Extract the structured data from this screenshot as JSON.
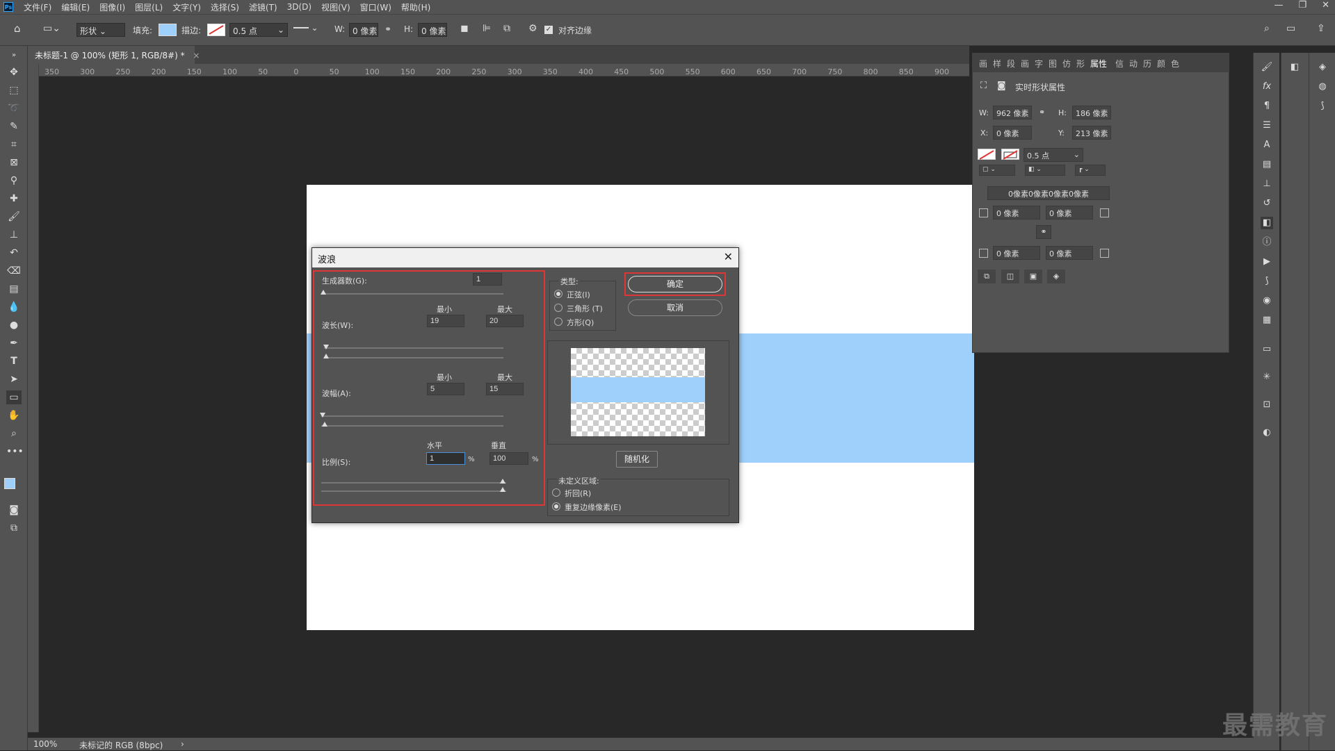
{
  "menubar": {
    "items": [
      "文件(F)",
      "编辑(E)",
      "图像(I)",
      "图层(L)",
      "文字(Y)",
      "选择(S)",
      "滤镜(T)",
      "3D(D)",
      "视图(V)",
      "窗口(W)",
      "帮助(H)"
    ],
    "logo": "Ps"
  },
  "options": {
    "mode": "形状",
    "fill_label": "填充:",
    "stroke_label": "描边:",
    "stroke_size": "0.5 点",
    "w_label": "W:",
    "w_value": "0 像素",
    "h_label": "H:",
    "h_value": "0 像素",
    "align_edges": "对齐边缘",
    "fill_color": "#9fd0fb"
  },
  "document": {
    "tab_title": "未标题-1 @ 100% (矩形 1, RGB/8#) *",
    "zoom": "100%",
    "status": "未标记的 RGB (8bpc)",
    "ruler_ticks": [
      "350",
      "300",
      "250",
      "200",
      "150",
      "100",
      "50",
      "0",
      "50",
      "100",
      "150",
      "200",
      "250",
      "300",
      "350",
      "400",
      "450",
      "500",
      "550",
      "600",
      "650",
      "700",
      "750",
      "800",
      "850",
      "900"
    ]
  },
  "dialog": {
    "title": "波浪",
    "generators_label": "生成器数(G):",
    "generators_value": "1",
    "min_label": "最小",
    "max_label": "最大",
    "wavelength_label": "波长(W):",
    "wavelength_min": "19",
    "wavelength_max": "20",
    "amplitude_label": "波幅(A):",
    "amplitude_min": "5",
    "amplitude_max": "15",
    "scale_label": "比例(S):",
    "horizontal_label": "水平",
    "vertical_label": "垂直",
    "scale_h": "1",
    "scale_v": "100",
    "percent": "%",
    "type_label": "类型:",
    "type_sine": "正弦(I)",
    "type_triangle": "三角形 (T)",
    "type_square": "方形(Q)",
    "ok": "确定",
    "cancel": "取消",
    "randomize": "随机化",
    "undefined_label": "未定义区域:",
    "wrap": "折回(R)",
    "repeat_edge": "重复边缘像素(E)",
    "highlight_color": "#e03535"
  },
  "properties": {
    "tabs": [
      "画",
      "样",
      "段",
      "画",
      "字",
      "图",
      "仿",
      "形",
      "属性",
      "信",
      "动",
      "历",
      "颜",
      "色"
    ],
    "active_tab": "属性",
    "title": "实时形状属性",
    "w_label": "W:",
    "w_value": "962 像素",
    "h_label": "H:",
    "h_value": "186 像素",
    "x_label": "X:",
    "x_value": "0 像素",
    "y_label": "Y:",
    "y_value": "213 像素",
    "stroke_size": "0.5 点",
    "corner_summary": "0像素0像素0像素0像素",
    "corner_tl": "0 像素",
    "corner_tr": "0 像素",
    "corner_bl": "0 像素",
    "corner_br": "0 像素"
  },
  "watermark": "最需教育"
}
